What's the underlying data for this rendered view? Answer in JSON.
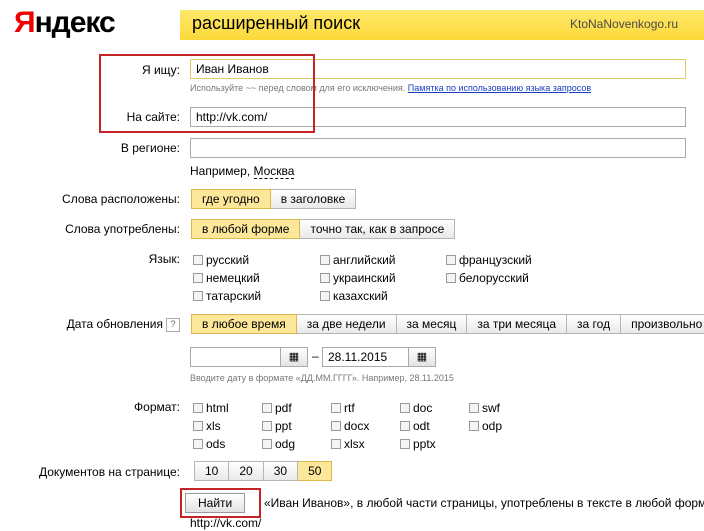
{
  "logo": {
    "first": "Я",
    "rest": "ндекс"
  },
  "header": {
    "title": "расширенный поиск",
    "watermark": "KtoNaNovenkogo.ru"
  },
  "query": {
    "label": "Я ищу:",
    "value": "Иван Иванов",
    "hint": "Используйте ~~ перед словом для его исключения.",
    "hint_link": "Памятка по использованию языка запросов"
  },
  "site": {
    "label": "На сайте:",
    "value": "http://vk.com/"
  },
  "region": {
    "label": "В регионе:",
    "value": "",
    "example_prefix": "Например,",
    "example_link": "Москва"
  },
  "words_position": {
    "label": "Слова расположены:",
    "options": [
      "где угодно",
      "в заголовке"
    ],
    "selected": "где угодно"
  },
  "words_form": {
    "label": "Слова употреблены:",
    "options": [
      "в любой форме",
      "точно так, как в запросе"
    ],
    "selected": "в любой форме"
  },
  "language": {
    "label": "Язык:",
    "options": [
      "русский",
      "английский",
      "французский",
      "немецкий",
      "украинский",
      "белорусский",
      "татарский",
      "казахский"
    ]
  },
  "date": {
    "label": "Дата обновления",
    "help": "?",
    "options": [
      "в любое время",
      "за две недели",
      "за месяц",
      "за три месяца",
      "за год",
      "произвольно"
    ],
    "selected": "в любое время",
    "from": "",
    "to": "28.11.2015",
    "dash": "–",
    "hint": "Вводите дату в формате «ДД.ММ.ГГГГ». Например, 28.11.2015"
  },
  "format": {
    "label": "Формат:",
    "options": [
      "html",
      "pdf",
      "rtf",
      "doc",
      "swf",
      "xls",
      "ppt",
      "docx",
      "odt",
      "odp",
      "ods",
      "odg",
      "xlsx",
      "pptx"
    ]
  },
  "per_page": {
    "label": "Документов на странице:",
    "options": [
      "10",
      "20",
      "30",
      "50"
    ],
    "selected": "50"
  },
  "find": {
    "label": "Найти",
    "summary": "«Иван Иванов», в любой части страницы, употреблены в тексте в любой форме",
    "site_line": "http://vk.com/"
  },
  "colors": {
    "accent": "#fcd93a",
    "highlight": "#c42426",
    "link": "#1a3dc1"
  }
}
